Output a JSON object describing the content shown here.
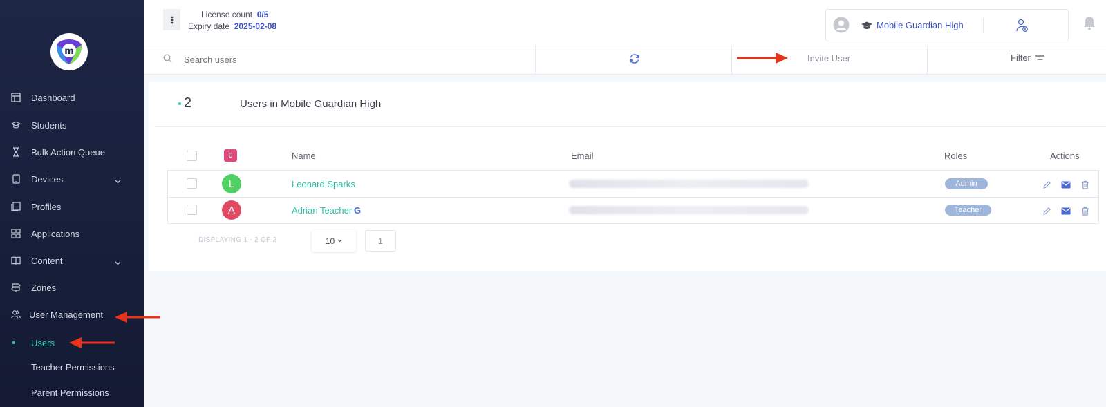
{
  "sidebar": {
    "items": [
      {
        "label": "Dashboard",
        "icon": "dashboard-icon"
      },
      {
        "label": "Students",
        "icon": "graduation-cap-icon"
      },
      {
        "label": "Bulk Action Queue",
        "icon": "hourglass-icon"
      },
      {
        "label": "Devices",
        "icon": "tablet-icon"
      },
      {
        "label": "Profiles",
        "icon": "profiles-icon"
      },
      {
        "label": "Applications",
        "icon": "grid-icon"
      },
      {
        "label": "Content",
        "icon": "book-icon"
      },
      {
        "label": "Zones",
        "icon": "signpost-icon"
      },
      {
        "label": "User Management",
        "icon": "users-icon"
      }
    ],
    "subitems": [
      {
        "label": "Users"
      },
      {
        "label": "Teacher Permissions"
      },
      {
        "label": "Parent Permissions"
      }
    ]
  },
  "header": {
    "license_label": "License count",
    "license_value": "0/5",
    "expiry_label": "Expiry date",
    "expiry_value": "2025-02-08",
    "school_name": "Mobile Guardian High"
  },
  "toolbar": {
    "search_placeholder": "Search users",
    "invite_label": "Invite User",
    "filter_label": "Filter"
  },
  "summary": {
    "count": "2",
    "title": "Users in Mobile Guardian High"
  },
  "table": {
    "selected_badge": "0",
    "columns": {
      "name": "Name",
      "email": "Email",
      "roles": "Roles",
      "actions": "Actions"
    },
    "rows": [
      {
        "initial": "L",
        "name": "Leonard Sparks",
        "role": "Admin",
        "avatar_color": "#4fd163"
      },
      {
        "initial": "A",
        "name": "Adrian Teacher",
        "role": "Teacher",
        "avatar_color": "#e04a63"
      }
    ]
  },
  "pagination": {
    "displaying": "DISPLAYING 1 - 2 OF 2",
    "page_size": "10",
    "page": "1"
  },
  "colors": {
    "accent": "#2fd1b8",
    "link": "#3d56c4",
    "annotation_arrow": "#e8321c"
  }
}
